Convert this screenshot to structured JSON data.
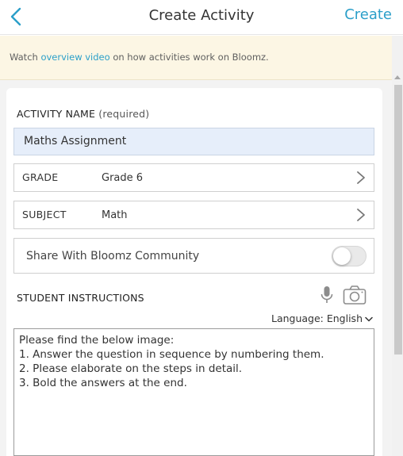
{
  "header": {
    "title": "Create Activity",
    "create_label": "Create",
    "back_icon": "chevron-left-icon"
  },
  "banner": {
    "prefix": "Watch",
    "link_text": "overview video",
    "suffix": "on how activities work on Bloomz."
  },
  "form": {
    "activity_name_label": "ACTIVITY NAME",
    "required_label": "(required)",
    "activity_name_value": "Maths Assignment",
    "grade": {
      "key": "GRADE",
      "value": "Grade 6"
    },
    "subject": {
      "key": "SUBJECT",
      "value": "Math"
    },
    "share_label": "Share With Bloomz Community",
    "share_enabled": false,
    "student_instructions_label": "STUDENT INSTRUCTIONS",
    "language_label": "Language: English",
    "instructions_lines": [
      "Please find the below image:",
      "1. Answer the question in sequence by numbering them.",
      "2. Please elaborate on the steps in detail.",
      "3. Bold the answers at the end."
    ]
  },
  "colors": {
    "accent": "#2b9fc9",
    "banner_bg": "#fcf6e4",
    "input_bg": "#e6eefa"
  }
}
